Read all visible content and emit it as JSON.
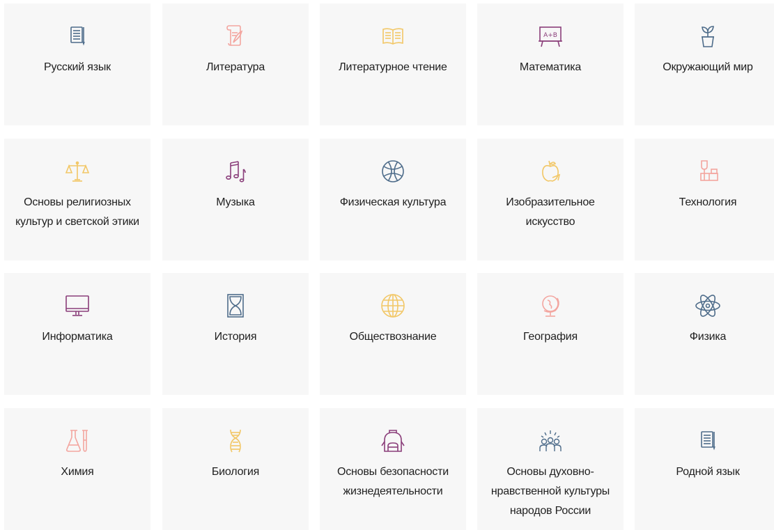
{
  "subjects": [
    {
      "label": "Русский язык",
      "icon": "document-pen-icon",
      "color": "#4e6c8a"
    },
    {
      "label": "Литература",
      "icon": "scroll-quill-icon",
      "color": "#f3a59f"
    },
    {
      "label": "Литературное чтение",
      "icon": "open-book-icon",
      "color": "#f2c766"
    },
    {
      "label": "Математика",
      "icon": "chalkboard-icon",
      "color": "#8a3e7a"
    },
    {
      "label": "Окружающий мир",
      "icon": "plant-pot-icon",
      "color": "#4e6c8a"
    },
    {
      "label": "Основы религиозных культур и светской этики",
      "icon": "scales-icon",
      "color": "#f2c766"
    },
    {
      "label": "Музыка",
      "icon": "music-notes-icon",
      "color": "#8a3e7a"
    },
    {
      "label": "Физическая культура",
      "icon": "basketball-icon",
      "color": "#4e6c8a"
    },
    {
      "label": "Изобразительное искусство",
      "icon": "apple-sketch-icon",
      "color": "#f2c766"
    },
    {
      "label": "Технология",
      "icon": "tools-icon",
      "color": "#f3a59f"
    },
    {
      "label": "Информатика",
      "icon": "monitor-icon",
      "color": "#8a3e7a"
    },
    {
      "label": "История",
      "icon": "hourglass-icon",
      "color": "#4e6c8a"
    },
    {
      "label": "Обществознание",
      "icon": "globe-grid-icon",
      "color": "#f2c766"
    },
    {
      "label": "География",
      "icon": "desk-globe-icon",
      "color": "#f3a59f"
    },
    {
      "label": "Физика",
      "icon": "atom-icon",
      "color": "#4e6c8a"
    },
    {
      "label": "Химия",
      "icon": "flask-icon",
      "color": "#f3a59f"
    },
    {
      "label": "Биология",
      "icon": "dna-icon",
      "color": "#f2c766"
    },
    {
      "label": "Основы безопасности жизнедеятельности",
      "icon": "backpack-icon",
      "color": "#8a3e7a"
    },
    {
      "label": "Основы духовно-нравственной культуры народов России",
      "icon": "people-group-icon",
      "color": "#4e6c8a"
    },
    {
      "label": "Родной язык",
      "icon": "document-pen-icon",
      "color": "#4e6c8a"
    }
  ]
}
